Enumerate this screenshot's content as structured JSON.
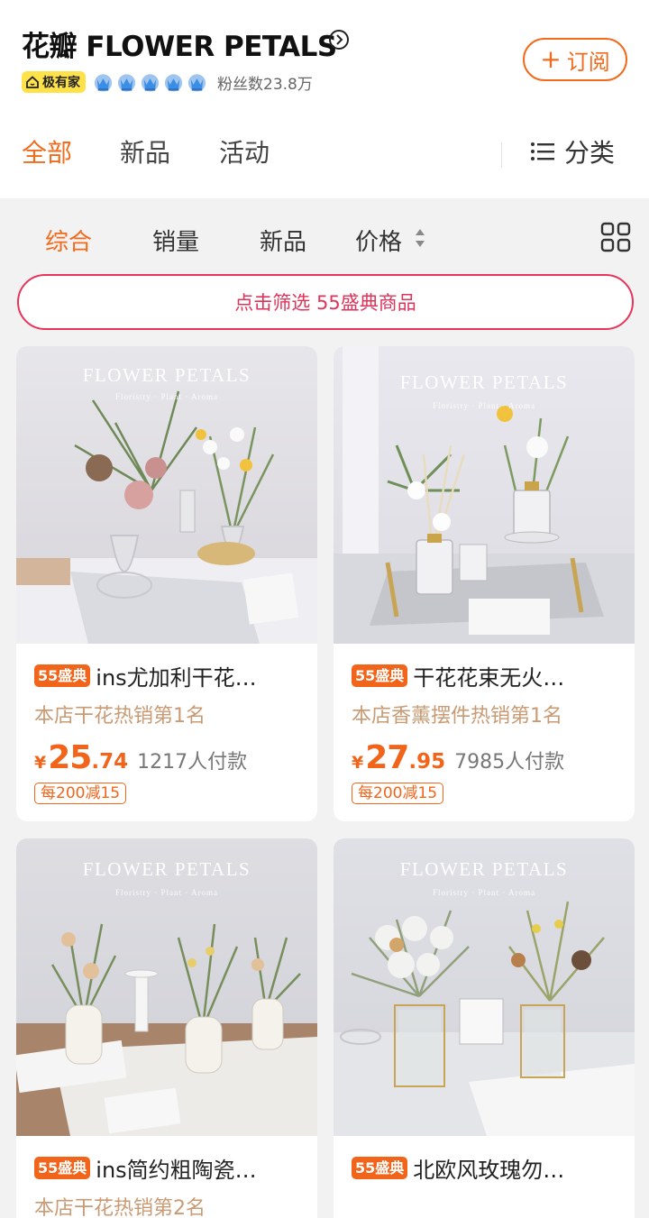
{
  "shop": {
    "name": "花瓣 FLOWER PETALS",
    "badge": "极有家",
    "fans": "粉丝数23.8万",
    "subscribe": "订阅"
  },
  "tabs": [
    "全部",
    "新品",
    "活动"
  ],
  "category_label": "分类",
  "sort": [
    "综合",
    "销量",
    "新品",
    "价格"
  ],
  "filter_banner": "点击筛选 55盛典商品",
  "tag_label": "55盛典",
  "brand_title": "FLOWER PETALS",
  "brand_subtitle": "Floristry · Plant · Aroma",
  "products": [
    {
      "title": "ins尤加利干花…",
      "rank": "本店干花热销第1名",
      "currency": "¥",
      "price_int": "25",
      "price_dec": ".74",
      "buyers": "1217人付款",
      "coupon": "每200减15"
    },
    {
      "title": "干花花束无火…",
      "rank": "本店香薰摆件热销第1名",
      "currency": "¥",
      "price_int": "27",
      "price_dec": ".95",
      "buyers": "7985人付款",
      "coupon": "每200减15"
    },
    {
      "title": "ins简约粗陶瓷…",
      "rank": "本店干花热销第2名"
    },
    {
      "title": "北欧风玫瑰勿…"
    }
  ],
  "colors": {
    "accent": "#f26a1b",
    "filter_red": "#e0335a",
    "rank_tan": "#c99a73"
  }
}
